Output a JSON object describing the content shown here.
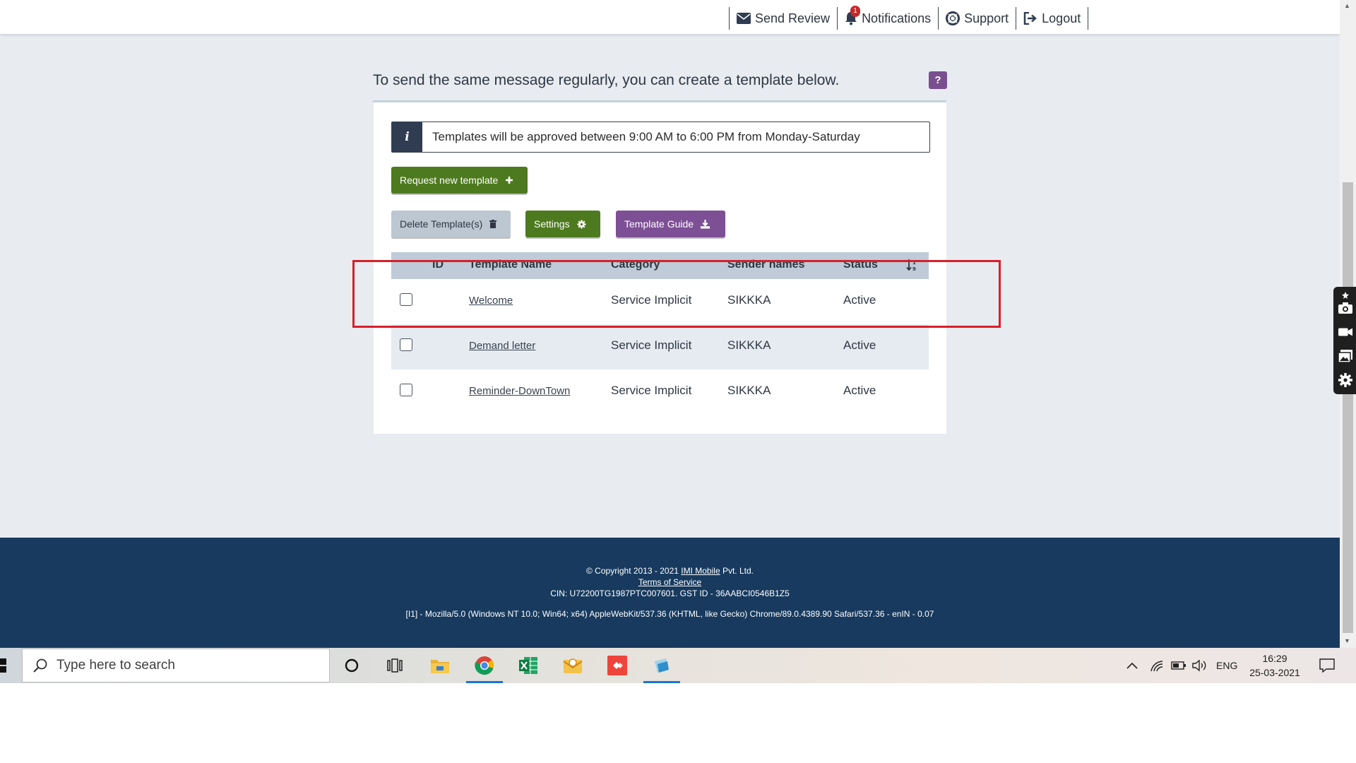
{
  "nav": {
    "send_review": "Send Review",
    "notifications": "Notifications",
    "notifications_count": "1",
    "support": "Support",
    "logout": "Logout"
  },
  "intro_text": "To send the same message regularly, you can create a template below.",
  "help_label": "?",
  "info": {
    "icon": "i",
    "text": "Templates will be approved between 9:00 AM to 6:00 PM from Monday-Saturday"
  },
  "buttons": {
    "request_new": "Request new template",
    "delete": "Delete Template(s)",
    "settings": "Settings",
    "guide": "Template Guide"
  },
  "table": {
    "headers": {
      "id": "ID",
      "name": "Template Name",
      "category": "Category",
      "sender": "Sender names",
      "status": "Status"
    },
    "rows": [
      {
        "name": "Welcome",
        "category": "Service Implicit",
        "sender": "SIKKKA",
        "status": "Active"
      },
      {
        "name": "Demand letter",
        "category": "Service Implicit",
        "sender": "SIKKKA",
        "status": "Active"
      },
      {
        "name": "Reminder-DownTown",
        "category": "Service Implicit",
        "sender": "SIKKKA",
        "status": "Active"
      }
    ]
  },
  "footer": {
    "copyright_pre": "© Copyright 2013 - 2021 ",
    "company_link": "IMI Mobile",
    "copyright_post": " Pvt. Ltd.",
    "terms": "Terms of Service",
    "cin": "CIN: U72200TG1987PTC007601. GST ID - 36AABCI0546B1Z5",
    "ua": "[I1] - Mozilla/5.0 (Windows NT 10.0; Win64; x64) AppleWebKit/537.36 (KHTML, like Gecko) Chrome/89.0.4389.90 Safari/537.36 - enIN - 0.07"
  },
  "taskbar": {
    "search_placeholder": "Type here to search",
    "language": "ENG",
    "time": "16:29",
    "date": "25-03-2021"
  },
  "colors": {
    "green": "#4d7a1e",
    "purple": "#7d4f95",
    "footer": "#173a5e",
    "highlight": "#d7202a"
  }
}
